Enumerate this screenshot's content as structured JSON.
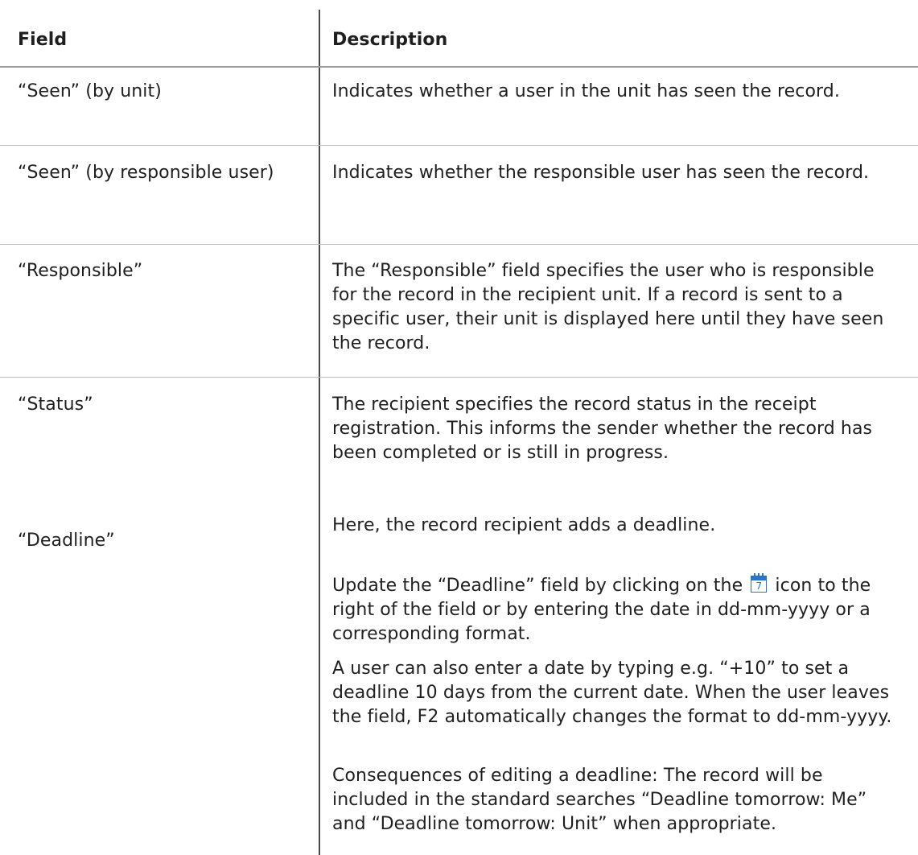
{
  "table": {
    "headers": {
      "field": "Field",
      "description": "Description"
    },
    "rows": [
      {
        "field": "“Seen” (by unit)",
        "description": "Indicates whether a user in the unit has seen the record."
      },
      {
        "field": "“Seen” (by responsible user)",
        "description": "Indicates whether the responsible user has seen the record."
      },
      {
        "field": "“Responsible”",
        "description": "The “Responsible” field specifies the user who is responsible for the record in the recipient unit. If a record is sent to a specific user, their unit is displayed here until they have seen the record."
      },
      {
        "field": "“Status”",
        "description": "The recipient specifies the record status in the receipt registration. This informs the sender whether the record has been completed or is still in progress."
      },
      {
        "field": "“Deadline”",
        "description": {
          "p1": "Here, the record recipient adds a deadline.",
          "p2_before": "Update the “Deadline” field by clicking on the",
          "p2_icon": "calendar-icon",
          "p2_icon_text": "7",
          "p2_after": "icon to the right of the field or by entering the date in dd-mm-yyyy or a corresponding format.",
          "p3": "A user can also enter a date by typing e.g. “+10” to set a deadline 10 days from the current date. When the user leaves the field, F2 automatically changes the format to dd-mm-yyyy.",
          "p4": "Consequences of editing a deadline: The record will be included in the standard searches “Deadline tomorrow: Me” and “Deadline tomorrow: Unit” when appropriate."
        }
      }
    ]
  }
}
